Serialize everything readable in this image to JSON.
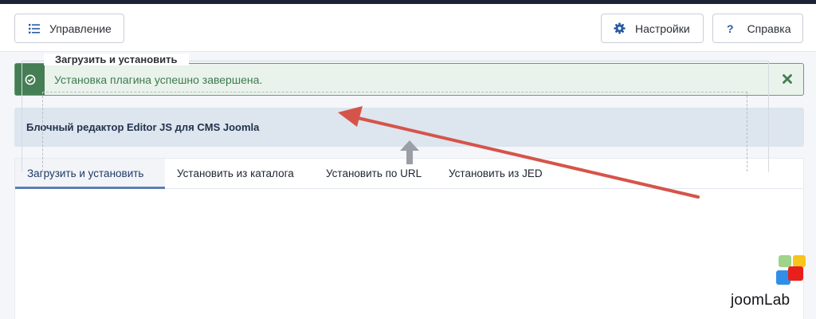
{
  "toolbar": {
    "manage_label": "Управление",
    "settings_label": "Настройки",
    "help_label": "Справка",
    "help_icon_glyph": "?"
  },
  "alert": {
    "message": "Установка плагина успешно завершена.",
    "type": "success",
    "accent_color": "#457d54"
  },
  "info": {
    "title": "Блочный редактор Editor JS для CMS Joomla"
  },
  "tabs": [
    {
      "label": "Загрузить и установить",
      "active": true
    },
    {
      "label": "Установить из каталога",
      "active": false
    },
    {
      "label": "Установить по URL",
      "active": false
    },
    {
      "label": "Установить из JED",
      "active": false
    }
  ],
  "upload": {
    "legend": "Загрузить и установить"
  },
  "brand": {
    "logo_text": "joomLab"
  },
  "icons": {
    "manage": "list-icon",
    "settings": "gear-icon",
    "help": "question-icon",
    "alert": "check-circle-icon",
    "close": "close-icon",
    "upload": "arrow-up-icon"
  },
  "annotation": {
    "color": "#d5544a"
  }
}
